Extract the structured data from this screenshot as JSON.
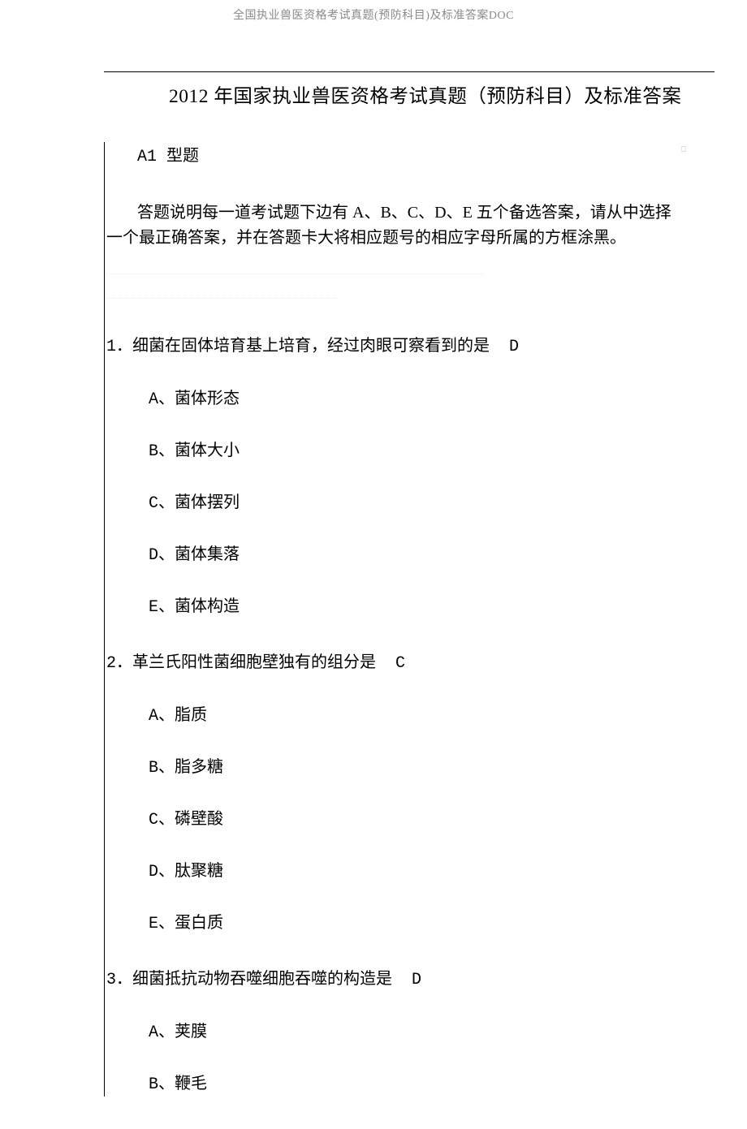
{
  "header_truncated": "全国执业兽医资格考试真题(预防科目)及标准答案DOC",
  "title": "2012 年国家执业兽医资格考试真题（预防科目）及标准答案",
  "section_type": "A1 型题",
  "instruction_line1": "答题说明每一道考试题下边有 A、B、C、D、E 五个备选答案，请从中选择",
  "instruction_line2": "一个最正确答案，并在答题卡大将相应题号的相应字母所属的方框涂黑。",
  "questions": [
    {
      "number": "1．",
      "stem": "细菌在固体培育基上培育，经过肉眼可察看到的是",
      "answer": "D",
      "options": [
        {
          "letter": "A、",
          "text": "菌体形态"
        },
        {
          "letter": "B、",
          "text": "菌体大小"
        },
        {
          "letter": "C、",
          "text": "菌体摆列"
        },
        {
          "letter": "D、",
          "text": "菌体集落"
        },
        {
          "letter": "E、",
          "text": "菌体构造"
        }
      ]
    },
    {
      "number": "2．",
      "stem": "革兰氏阳性菌细胞壁独有的组分是",
      "answer": "C",
      "options": [
        {
          "letter": "A、",
          "text": "脂质"
        },
        {
          "letter": "B、",
          "text": "脂多糖"
        },
        {
          "letter": "C、",
          "text": "磷壁酸"
        },
        {
          "letter": "D、",
          "text": "肽聚糖"
        },
        {
          "letter": "E、",
          "text": "蛋白质"
        }
      ]
    },
    {
      "number": "3．",
      "stem": "细菌抵抗动物吞噬细胞吞噬的构造是",
      "answer": "D",
      "options": [
        {
          "letter": "A、",
          "text": "荚膜"
        },
        {
          "letter": "B、",
          "text": "鞭毛"
        }
      ]
    }
  ]
}
